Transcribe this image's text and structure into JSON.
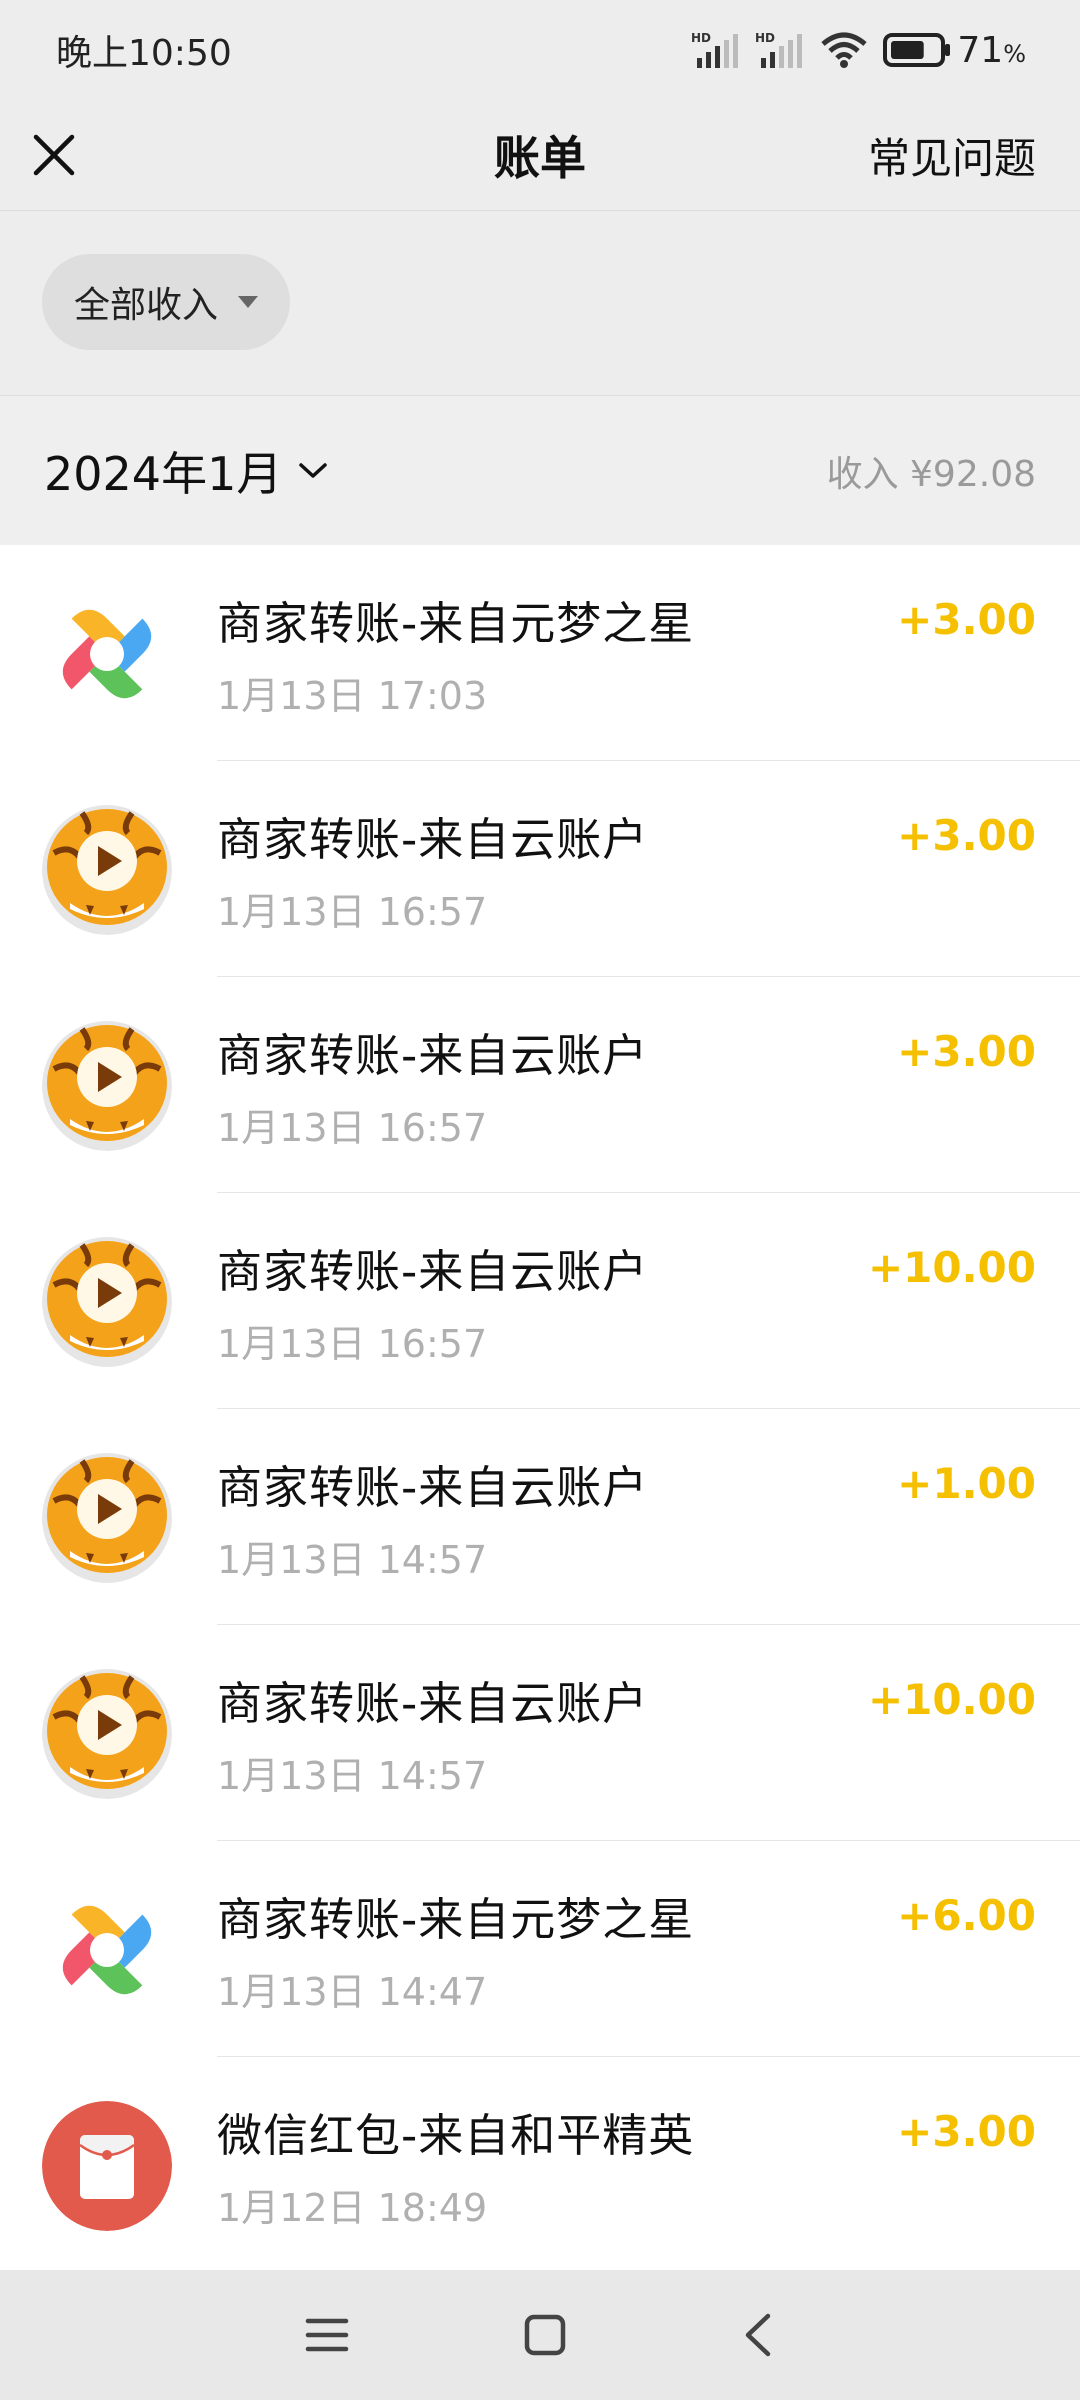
{
  "status_bar": {
    "time": "晚上10:50",
    "signal1_label": "HD",
    "signal2_label": "HD",
    "battery_percent": "71",
    "battery_unit": "%",
    "battery_level": 0.71
  },
  "nav": {
    "title": "账单",
    "faq_label": "常见问题",
    "close_icon": "close-icon"
  },
  "filter": {
    "label": "全部收入"
  },
  "month": {
    "label": "2024年1月",
    "income_label": "收入",
    "income_value": "¥92.08"
  },
  "transactions": [
    {
      "icon": "yuanmeng-star-logo",
      "title": "商家转账-来自元梦之星",
      "time": "1月13日 17:03",
      "amount": "+3.00"
    },
    {
      "icon": "cloud-account-tiger-logo",
      "title": "商家转账-来自云账户",
      "time": "1月13日 16:57",
      "amount": "+3.00"
    },
    {
      "icon": "cloud-account-tiger-logo",
      "title": "商家转账-来自云账户",
      "time": "1月13日 16:57",
      "amount": "+3.00"
    },
    {
      "icon": "cloud-account-tiger-logo",
      "title": "商家转账-来自云账户",
      "time": "1月13日 16:57",
      "amount": "+10.00"
    },
    {
      "icon": "cloud-account-tiger-logo",
      "title": "商家转账-来自云账户",
      "time": "1月13日 14:57",
      "amount": "+1.00"
    },
    {
      "icon": "cloud-account-tiger-logo",
      "title": "商家转账-来自云账户",
      "time": "1月13日 14:57",
      "amount": "+10.00"
    },
    {
      "icon": "yuanmeng-star-logo",
      "title": "商家转账-来自元梦之星",
      "time": "1月13日 14:47",
      "amount": "+6.00"
    },
    {
      "icon": "red-packet-icon",
      "title": "微信红包-来自和平精英",
      "time": "1月12日 18:49",
      "amount": "+3.00"
    }
  ],
  "colors": {
    "amount": "#f5c000",
    "background": "#ededed",
    "red_packet": "#e25a4c",
    "tiger_orange": "#f4a21a"
  },
  "system_nav": [
    "menu-icon",
    "home-icon",
    "back-icon"
  ]
}
